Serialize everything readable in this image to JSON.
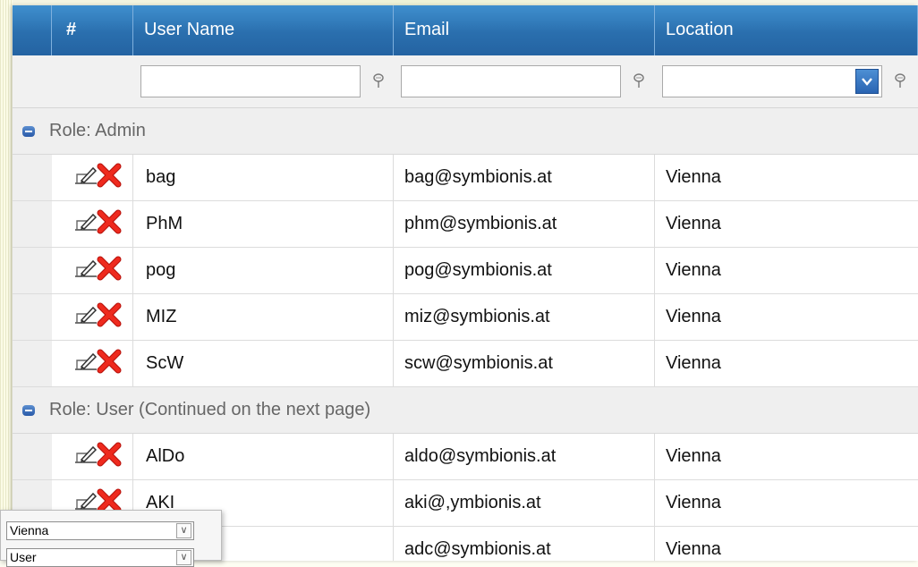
{
  "header": {
    "num": "#",
    "user_name": "User Name",
    "email": "Email",
    "location": "Location"
  },
  "icons": {
    "filter": "filter-icon",
    "edit": "edit-pencil-icon",
    "delete": "delete-x-icon",
    "collapse": "collapse-minus-icon"
  },
  "colors": {
    "header": "#2a6fae",
    "delete": "#e8231a"
  },
  "groups": [
    {
      "label": "Role: Admin",
      "rows": [
        {
          "user": "bag",
          "email": "bag@symbionis.at",
          "location": "Vienna"
        },
        {
          "user": "PhM",
          "email": "phm@symbionis.at",
          "location": "Vienna"
        },
        {
          "user": "pog",
          "email": "pog@symbionis.at",
          "location": "Vienna"
        },
        {
          "user": "MIZ",
          "email": "miz@symbionis.at",
          "location": "Vienna"
        },
        {
          "user": "ScW",
          "email": "scw@symbionis.at",
          "location": "Vienna"
        }
      ]
    },
    {
      "label": "Role: User (Continued on the next page)",
      "rows": [
        {
          "user": "AlDo",
          "email": "aldo@symbionis.at",
          "location": "Vienna"
        },
        {
          "user": "AKI",
          "email": "aki@,ymbionis.at",
          "location": "Vienna"
        },
        {
          "user": "",
          "email": "adc@symbionis.at",
          "location": "Vienna"
        }
      ]
    }
  ],
  "popup": {
    "location_value": "Vienna",
    "role_value": "User"
  }
}
